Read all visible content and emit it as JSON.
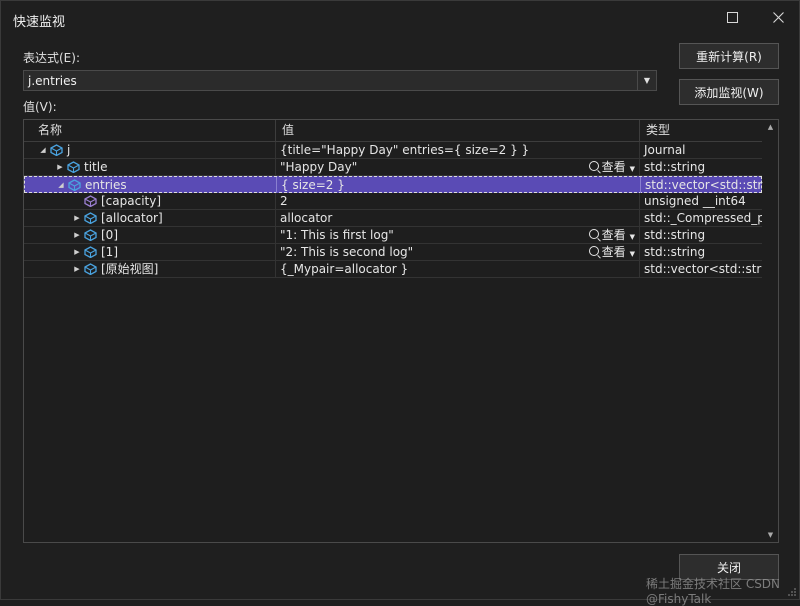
{
  "window": {
    "title": "快速监视",
    "maximize_icon": "maximize-icon",
    "close_icon": "close-icon"
  },
  "expression": {
    "label": "表达式(E):",
    "value": "j.entries"
  },
  "value_label": "值(V):",
  "buttons": {
    "recalculate": "重新计算(R)",
    "add_watch": "添加监视(W)",
    "close": "关闭"
  },
  "table": {
    "headers": [
      "名称",
      "值",
      "类型"
    ],
    "view_label": "查看",
    "rows": [
      {
        "name": "j",
        "value": "{title=\"Happy Day\" entries={ size=2 } }",
        "type": "Journal",
        "level": 0,
        "expander": "expanded",
        "icon": "object-icon",
        "view": false,
        "selected": false
      },
      {
        "name": "title",
        "value": "\"Happy Day\"",
        "type": "std::string",
        "level": 1,
        "expander": "collapsed",
        "icon": "object-icon",
        "view": true,
        "selected": false
      },
      {
        "name": "entries",
        "value": "{ size=2 }",
        "type": "std::vector<std::stri...",
        "level": 1,
        "expander": "expanded",
        "icon": "object-icon",
        "view": false,
        "selected": true
      },
      {
        "name": "[capacity]",
        "value": "2",
        "type": "unsigned __int64",
        "level": 2,
        "expander": "none",
        "icon": "field-icon",
        "view": false,
        "selected": false
      },
      {
        "name": "[allocator]",
        "value": "allocator",
        "type": "std::_Compressed_p...",
        "level": 2,
        "expander": "collapsed",
        "icon": "object-icon",
        "view": false,
        "selected": false
      },
      {
        "name": "[0]",
        "value": "\"1: This is first log\"",
        "type": "std::string",
        "level": 2,
        "expander": "collapsed",
        "icon": "object-icon",
        "view": true,
        "selected": false
      },
      {
        "name": "[1]",
        "value": "\"2: This is second log\"",
        "type": "std::string",
        "level": 2,
        "expander": "collapsed",
        "icon": "object-icon",
        "view": true,
        "selected": false
      },
      {
        "name": "[原始视图]",
        "value": "{_Mypair=allocator }",
        "type": "std::vector<std::stri...",
        "level": 2,
        "expander": "collapsed",
        "icon": "object-icon",
        "view": false,
        "selected": false
      }
    ]
  },
  "watermark": "稀土掘金技术社区 CSDN @FishyTalk",
  "colors": {
    "selection": "#5a4bb5",
    "icon_blue": "#4aa3e0",
    "icon_purple": "#9b7fd1"
  }
}
